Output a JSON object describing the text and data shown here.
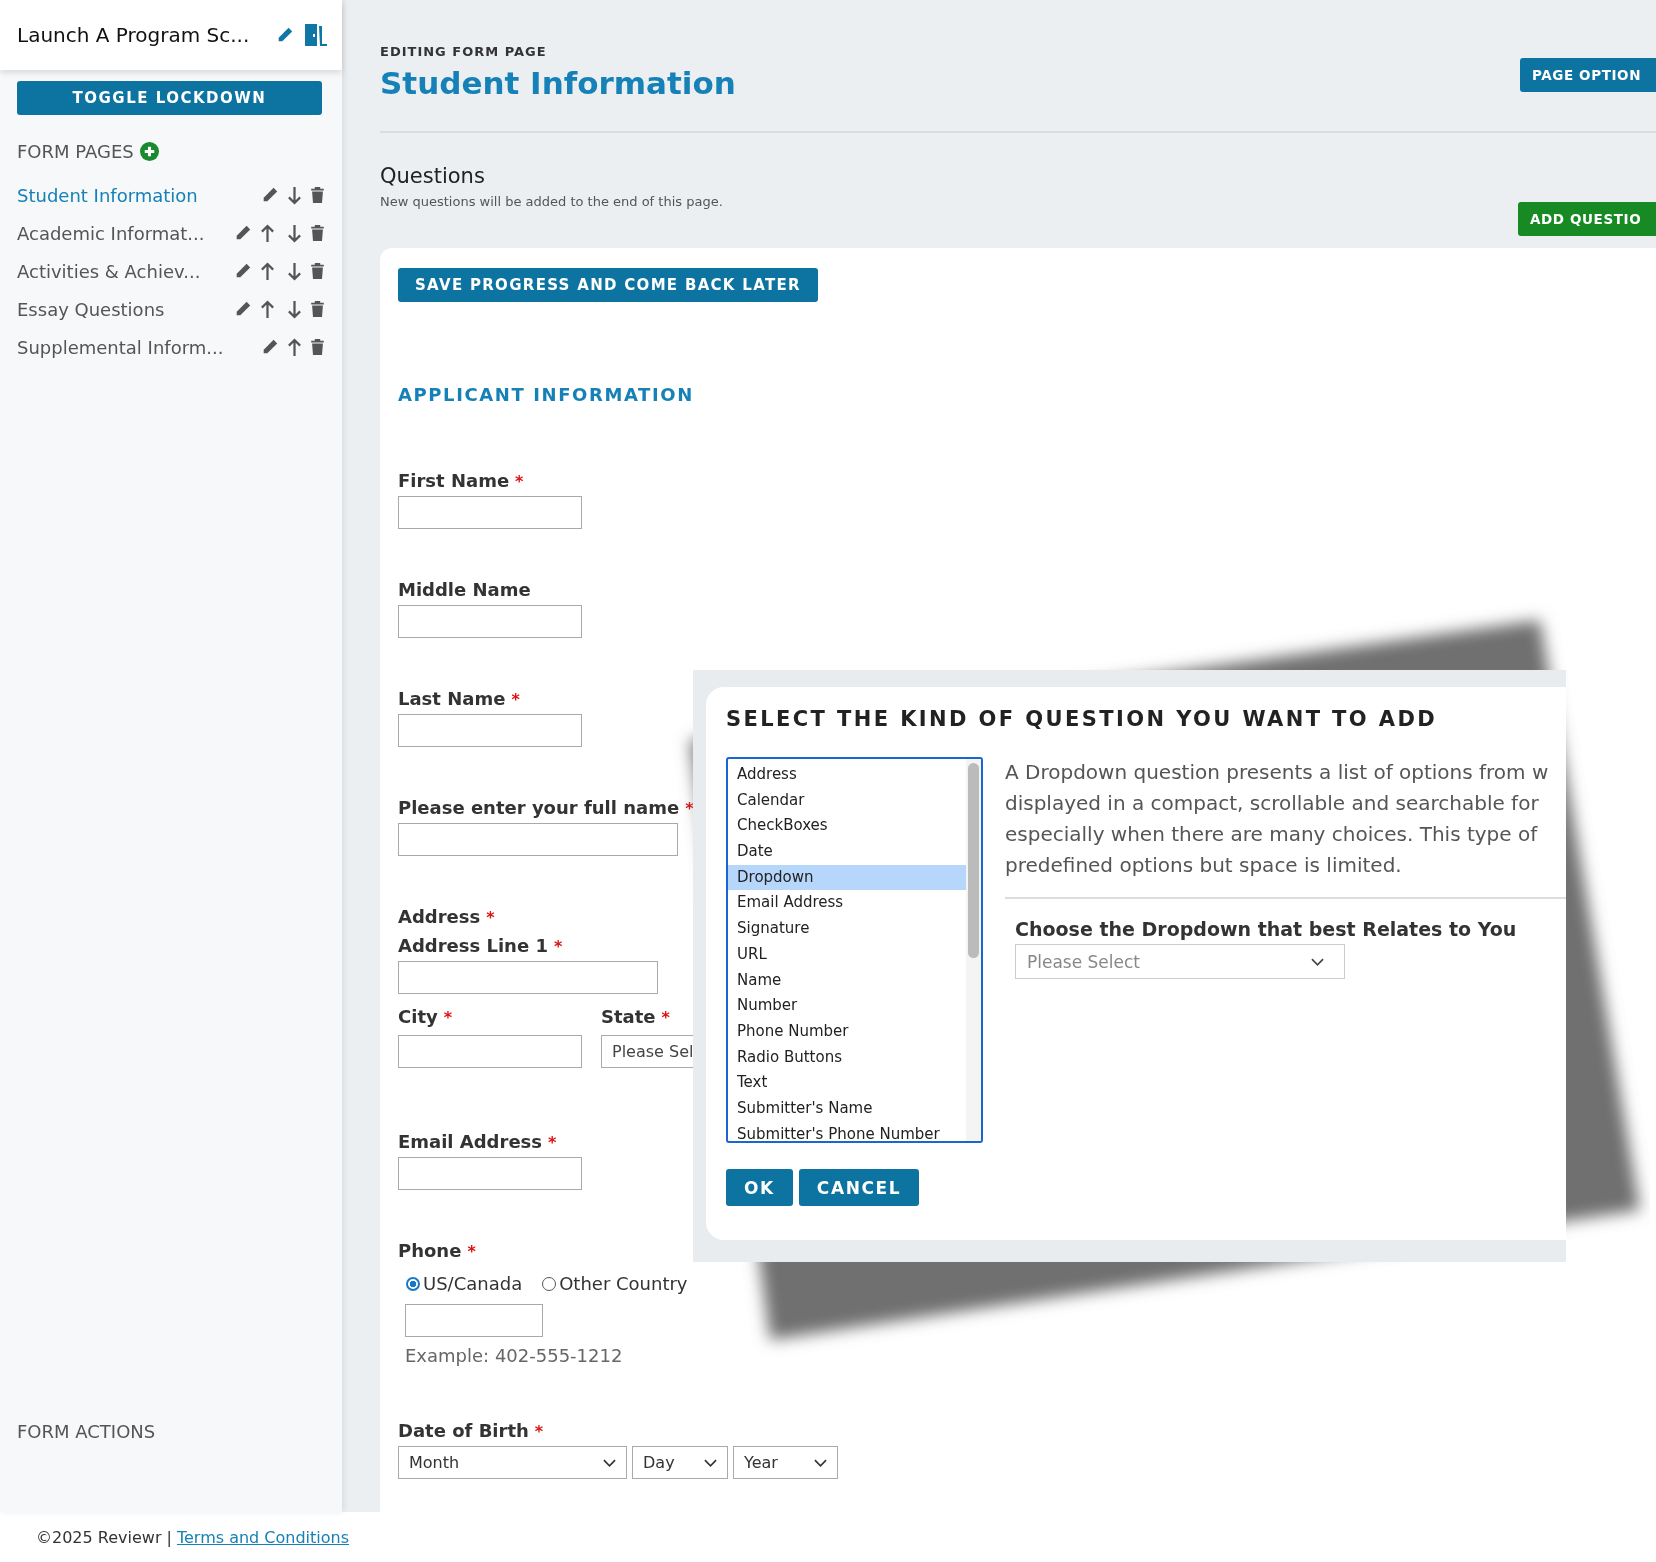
{
  "sidebar": {
    "title": "Launch A Program Sc...",
    "lockdown_button": "TOGGLE LOCKDOWN",
    "pages_heading": "FORM PAGES",
    "pages": [
      {
        "label": "Student Information",
        "selected": true,
        "can_move_up": false,
        "can_move_down": true
      },
      {
        "label": "Academic Informat...",
        "selected": false,
        "can_move_up": true,
        "can_move_down": true
      },
      {
        "label": "Activities & Achiev...",
        "selected": false,
        "can_move_up": true,
        "can_move_down": true
      },
      {
        "label": "Essay Questions",
        "selected": false,
        "can_move_up": true,
        "can_move_down": true
      },
      {
        "label": "Supplemental Inform...",
        "selected": false,
        "can_move_up": true,
        "can_move_down": false
      }
    ],
    "actions_heading": "FORM ACTIONS"
  },
  "header": {
    "eyebrow": "EDITING FORM PAGE",
    "title": "Student Information",
    "options_button": "PAGE OPTION"
  },
  "questions": {
    "title": "Questions",
    "subtitle": "New questions will be added to the end of this page.",
    "add_button": "ADD QUESTIO"
  },
  "form": {
    "required_mark": "*",
    "save_button": "SAVE PROGRESS AND COME BACK LATER",
    "section_title": "APPLICANT INFORMATION",
    "fields": [
      {
        "kind": "text",
        "label": "First Name",
        "required": true
      },
      {
        "kind": "text",
        "label": "Middle Name",
        "required": false
      },
      {
        "kind": "text",
        "label": "Last Name",
        "required": true
      },
      {
        "kind": "longtext",
        "label": "Please enter your full name",
        "required": true
      },
      {
        "kind": "address",
        "label": "Address",
        "required": true,
        "line1": {
          "label": "Address Line 1",
          "required": true
        },
        "city": {
          "label": "City",
          "required": true
        },
        "state": {
          "label": "State",
          "required": true,
          "placeholder": "Please Sel"
        }
      },
      {
        "kind": "text",
        "label": "Email Address",
        "required": true
      },
      {
        "kind": "phone",
        "label": "Phone",
        "required": true,
        "options": [
          {
            "label": "US/Canada",
            "selected": true
          },
          {
            "label": "Other Country",
            "selected": false
          }
        ],
        "hint": "Example: 402-555-1212"
      },
      {
        "kind": "date",
        "label": "Date of Birth",
        "required": true,
        "placeholders": [
          "Month",
          "Day",
          "Year"
        ]
      }
    ]
  },
  "dialog": {
    "title": "SELECT THE KIND OF QUESTION YOU WANT TO ADD",
    "types": [
      {
        "label": "Address",
        "selected": false
      },
      {
        "label": "Calendar",
        "selected": false
      },
      {
        "label": "CheckBoxes",
        "selected": false
      },
      {
        "label": "Date",
        "selected": false
      },
      {
        "label": "Dropdown",
        "selected": true
      },
      {
        "label": "Email Address",
        "selected": false
      },
      {
        "label": "Signature",
        "selected": false
      },
      {
        "label": "URL",
        "selected": false
      },
      {
        "label": "Name",
        "selected": false
      },
      {
        "label": "Number",
        "selected": false
      },
      {
        "label": "Phone Number",
        "selected": false
      },
      {
        "label": "Radio Buttons",
        "selected": false
      },
      {
        "label": "Text",
        "selected": false
      },
      {
        "label": "Submitter's Name",
        "selected": false
      },
      {
        "label": "Submitter's Phone Number",
        "selected": false
      }
    ],
    "description_lines": [
      "A Dropdown question presents a list of options from w",
      "displayed in a compact, scrollable and searchable for",
      "especially when there are many choices. This type of",
      "predefined options but space is limited."
    ],
    "preview": {
      "label": "Choose the Dropdown that best Relates to You",
      "placeholder": "Please Select"
    },
    "buttons": [
      "OK",
      "CANCEL"
    ]
  },
  "footer": {
    "copyright": "©2025 Reviewr |",
    "link": "Terms and Conditions"
  }
}
